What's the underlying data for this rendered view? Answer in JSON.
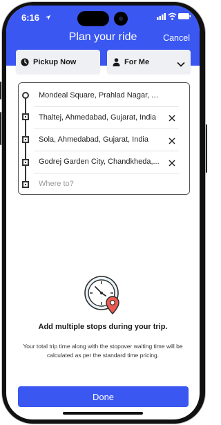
{
  "status": {
    "time": "6:16"
  },
  "header": {
    "title": "Plan your ride",
    "cancel_label": "Cancel"
  },
  "selectors": {
    "pickup_label": "Pickup Now",
    "rider_label": "For Me"
  },
  "stops": [
    {
      "label": "Mondeal Square, Prahlad Nagar, Ahme..."
    },
    {
      "label": "Thaltej, Ahmedabad, Gujarat, India"
    },
    {
      "label": "Sola, Ahmedabad, Gujarat, India"
    },
    {
      "label": "Godrej Garden City, Chandkheda,..."
    }
  ],
  "destination": {
    "placeholder": "Where to?"
  },
  "info": {
    "title": "Add multiple stops during your trip.",
    "body": "Your total trip time along with the stopover waiting time will be calculated as per the standard time pricing."
  },
  "actions": {
    "done_label": "Done"
  },
  "colors": {
    "accent": "#3a57f2",
    "marker": "#e85a50"
  }
}
